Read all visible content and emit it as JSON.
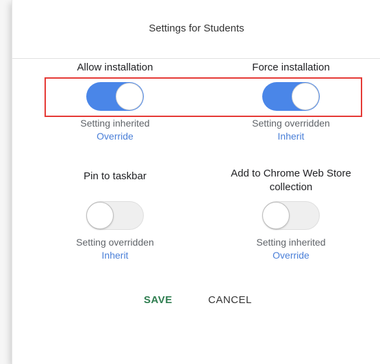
{
  "dialog": {
    "title": "Settings for Students"
  },
  "settings": [
    {
      "label": "Allow installation",
      "state": "on",
      "status": "Setting inherited",
      "action": "Override"
    },
    {
      "label": "Force installation",
      "state": "on",
      "status": "Setting overridden",
      "action": "Inherit"
    },
    {
      "label": "Pin to taskbar",
      "state": "off",
      "status": "Setting overridden",
      "action": "Inherit"
    },
    {
      "label": "Add to Chrome Web Store collection",
      "state": "off",
      "status": "Setting inherited",
      "action": "Override"
    }
  ],
  "actions": {
    "save_label": "SAVE",
    "cancel_label": "CANCEL"
  },
  "colors": {
    "toggle_on": "#4a86e8",
    "link": "#4a7fd8",
    "save": "#2e7d4f",
    "highlight": "#e53935"
  }
}
